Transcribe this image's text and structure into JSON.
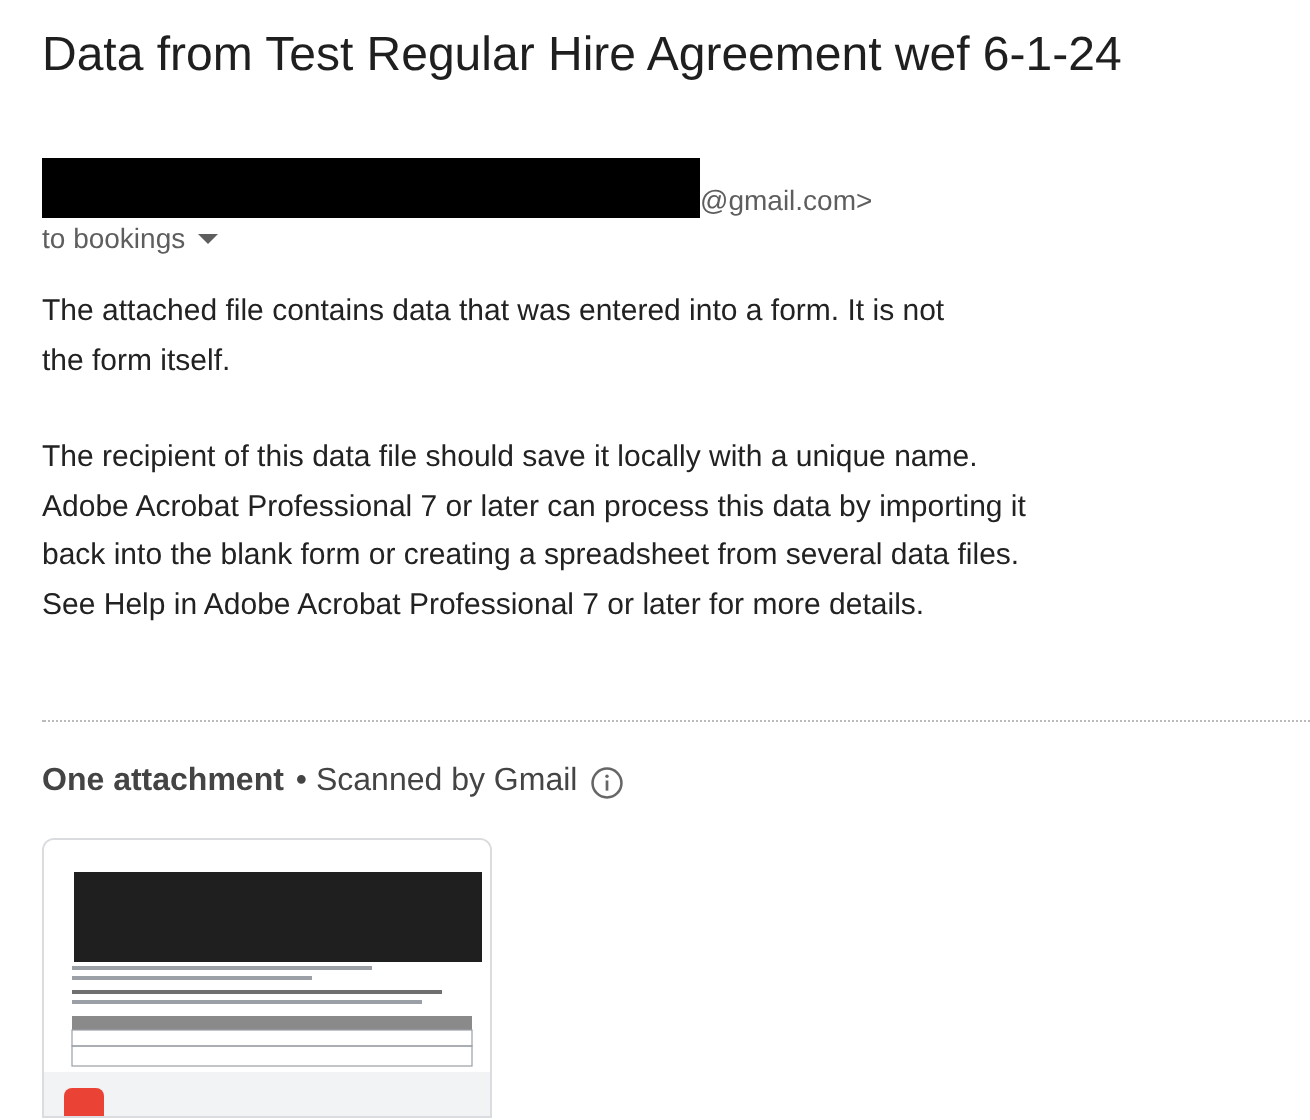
{
  "subject": "Data from Test Regular Hire Agreement wef 6-1-24",
  "sender": {
    "email_tail": "@gmail.com>",
    "recipient": "to bookings"
  },
  "body": [
    "The attached file contains data that was entered into a form. It is not the form itself.",
    "The recipient of this data file should save it locally with a unique name. Adobe Acrobat Professional 7 or later can process this data by importing it back into the blank form or creating a spreadsheet from several data files. See Help in Adobe Acrobat Professional 7 or later for more details."
  ],
  "attachments": {
    "heading": "One attachment",
    "scan_note": "• Scanned by Gmail"
  }
}
